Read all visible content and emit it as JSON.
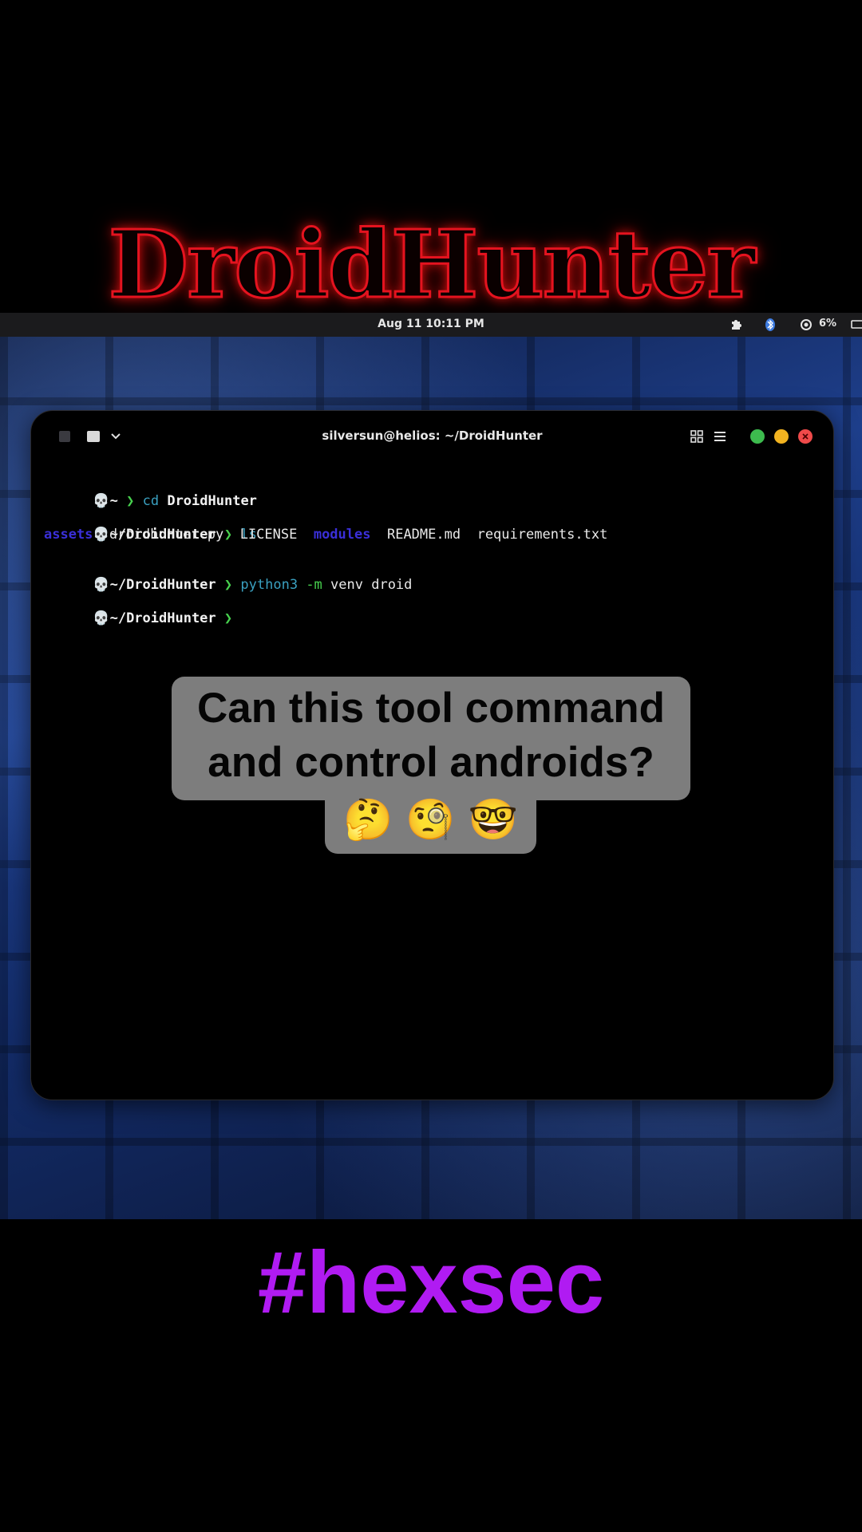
{
  "overlay": {
    "headline": "DroidHunter",
    "caption_lines": [
      "Can this tool command",
      "and control androids?"
    ],
    "caption_emojis": "🤔 🧐 🤓",
    "hashtag": "#hexsec"
  },
  "topbar": {
    "datetime": "Aug 11  10:11 PM",
    "battery": "6%",
    "icons": [
      "puzzle-icon",
      "bluetooth-icon",
      "battery-icon",
      "display-icon"
    ]
  },
  "terminal": {
    "title": "silversun@helios: ~/DroidHunter",
    "prompt_skull": "💀",
    "prompt_arrow": "❯",
    "lines": [
      {
        "path": "~",
        "cmd": "cd",
        "arg": "DroidHunter"
      },
      {
        "path": "~/DroidHunter",
        "cmd": "ls",
        "arg": ""
      },
      {
        "path": "~/DroidHunter",
        "cmd": "python3",
        "flag": "-m",
        "arg": "venv droid"
      },
      {
        "path": "~/DroidHunter",
        "cmd": "",
        "arg": ""
      }
    ],
    "ls_output": [
      "assets",
      "droidhunter.py",
      "LICENSE",
      "modules",
      "README.md",
      "requirements.txt"
    ],
    "window_buttons": {
      "green": "#3dbb4e",
      "yellow": "#f2b320",
      "red": "#ef4a4a"
    }
  },
  "dock": {
    "items": [
      "tiling-manager",
      "terminal",
      "software-center",
      "text-editor",
      "brave-browser",
      "app-grid"
    ]
  },
  "colors": {
    "headline_stroke": "#e4131f",
    "hashtag": "#b01bf2",
    "prompt_arrow": "#47d14e",
    "command": "#3aa0c0",
    "directory": "#3a2fd8",
    "caption_bg": "#7d7d7d"
  }
}
